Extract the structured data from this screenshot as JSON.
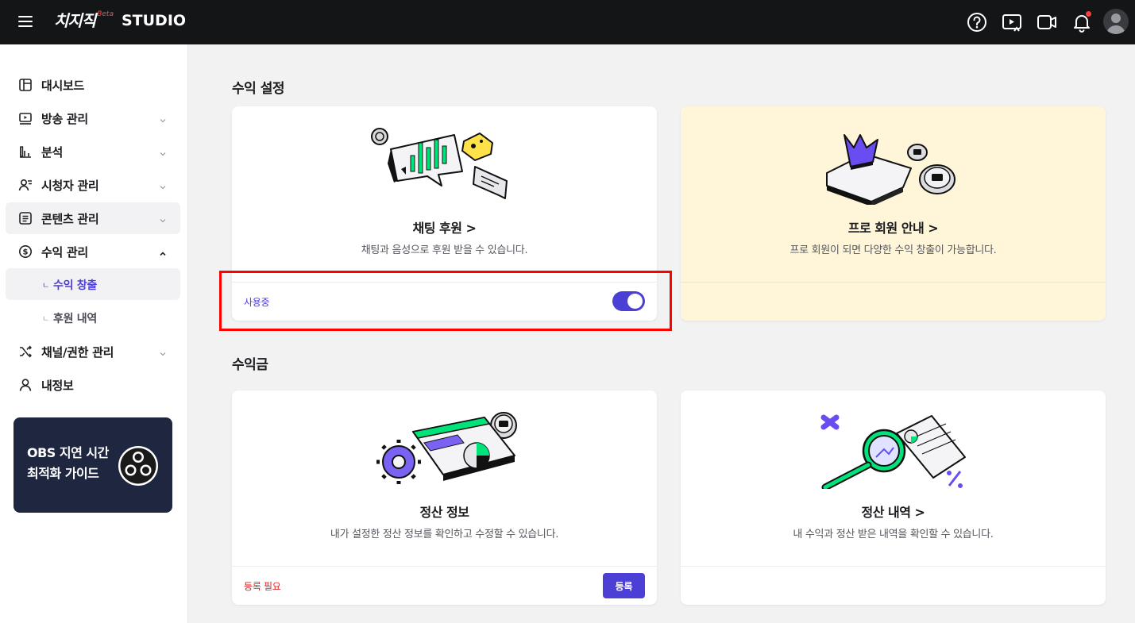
{
  "header": {
    "logo_text": "치지직",
    "logo_beta": "Beta",
    "logo_studio": "STUDIO",
    "icons": [
      "help-icon",
      "live-play-icon",
      "video-camera-icon",
      "bell-icon",
      "avatar"
    ],
    "bell_has_notification": true
  },
  "sidebar": {
    "items": [
      {
        "label": "대시보드",
        "icon": "dashboard-icon",
        "chevron": false
      },
      {
        "label": "방송 관리",
        "icon": "broadcast-icon",
        "chevron": "down"
      },
      {
        "label": "분석",
        "icon": "analytics-icon",
        "chevron": "down"
      },
      {
        "label": "시청자 관리",
        "icon": "viewers-icon",
        "chevron": "down"
      },
      {
        "label": "콘텐츠 관리",
        "icon": "content-icon",
        "chevron": "down",
        "active": true
      },
      {
        "label": "수익 관리",
        "icon": "revenue-icon",
        "chevron": "up",
        "expanded": true
      },
      {
        "label": "채널/권한 관리",
        "icon": "channel-icon",
        "chevron": "down"
      },
      {
        "label": "내정보",
        "icon": "profile-icon",
        "chevron": false
      }
    ],
    "sub_items": [
      {
        "label": "수익 창출",
        "active": true
      },
      {
        "label": "후원 내역",
        "active": false
      }
    ],
    "banner": {
      "line1": "OBS 지연 시간",
      "line2": "최적화 가이드"
    }
  },
  "main": {
    "section1_title": "수익 설정",
    "section2_title": "수익금",
    "cards": [
      {
        "title": "채팅 후원 >",
        "desc": "채팅과 음성으로 후원 받을 수 있습니다.",
        "status": "사용중",
        "status_color": "#4b3fd6",
        "toggle_on": true
      },
      {
        "title": "프로 회원 안내 >",
        "desc": "프로 회원이 되면 다양한 수익 창출이 가능합니다."
      },
      {
        "title": "정산 정보",
        "desc": "내가 설정한 정산 정보를 확인하고 수정할 수 있습니다.",
        "status": "등록 필요",
        "status_color": "#e02020",
        "button": "등록"
      },
      {
        "title": "정산 내역 >",
        "desc": "내 수익과 정산 받은 내역을 확인할 수 있습니다."
      }
    ]
  },
  "colors": {
    "accent": "#4b3fd6",
    "topbar": "#141517",
    "highlight": "#ff0000",
    "pro_card_bg": "#fff6da"
  }
}
